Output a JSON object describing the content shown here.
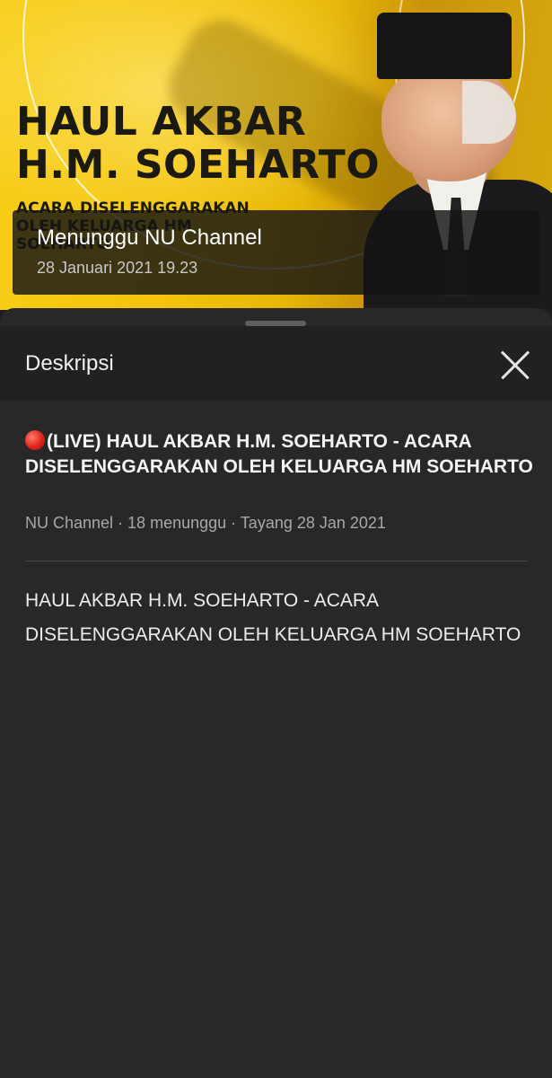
{
  "video": {
    "headline_line1": "HAUL AKBAR",
    "headline_line2": "H.M. SOEHARTO",
    "subline": "ACARA DISELENGGARAKAN OLEH KELUARGA HM SOEHARTO",
    "overlay_title": "Menunggu NU Channel",
    "overlay_date": "28 Januari 2021 19.23",
    "background_color": "#f4c30a"
  },
  "sheet": {
    "header_label": "Deskripsi",
    "close_icon": "close-icon",
    "video_title": "(LIVE) HAUL AKBAR H.M. SOEHARTO - ACARA DISELENGGARAKAN OLEH KELUARGA HM SOEHARTO",
    "live_indicator_color": "#e0241a",
    "meta": "NU Channel · 18 menunggu · Tayang 28 Jan 2021",
    "description": "HAUL AKBAR H.M. SOEHARTO - ACARA DISELENGGARAKAN OLEH KELUARGA HM SOEHARTO"
  }
}
